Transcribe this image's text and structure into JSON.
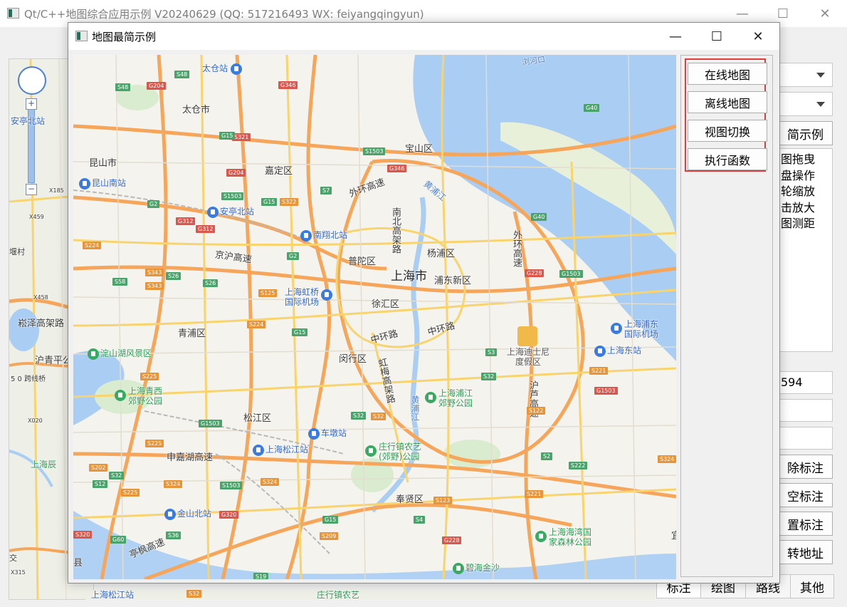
{
  "main_window": {
    "title": "Qt/C++地图综合应用示例 V20240629 (QQ: 517216493 WX: feiyangqingyun)",
    "minimize": "—",
    "maximize": "☐",
    "close": "✕"
  },
  "back_map_labels": {
    "l1": "安亭北站",
    "l2": "X185",
    "l3": "X459",
    "l4": "堰村",
    "l5": "X458",
    "l6": "崧泽高架路",
    "l7": "沪青平公",
    "l8": "5 0 跨线桥",
    "l9": "X020",
    "l10": "上海辰",
    "l11": "交",
    "l12": "X315",
    "l13": "上海松江站",
    "l14": "庄行镇农艺",
    "l15": "S32"
  },
  "right_panel": {
    "demo_button": "简示例",
    "list_items": [
      "图拖曳",
      "盘操作",
      "轮缩放",
      "击放大",
      "图测距"
    ],
    "coordinate_value": "594",
    "remove_marker": "除标注",
    "clear_marker": "空标注",
    "reset_marker": "置标注",
    "coord_to_address": "转地址",
    "tabs": [
      "标注",
      "绘图",
      "路线",
      "其他"
    ]
  },
  "dialog": {
    "title": "地图最简示例",
    "minimize": "—",
    "maximize": "☐",
    "close": "✕",
    "buttons": {
      "online_map": "在线地图",
      "offline_map": "离线地图",
      "view_switch": "视图切换",
      "exec_function": "执行函数"
    }
  },
  "colors": {
    "highlight_border": "#e23b3b",
    "water": "#a9cdf3",
    "highway": "#f5a65b",
    "arterial": "#f9d36c"
  },
  "map": {
    "city": "上海市",
    "districts": [
      "太仓市",
      "昆山市",
      "嘉定区",
      "宝山区",
      "普陀区",
      "杨浦区",
      "浦东新区",
      "徐汇区",
      "青浦区",
      "闵行区",
      "松江区",
      "奉贤区"
    ],
    "roads": [
      "外环高速",
      "京沪高速",
      "中环路",
      "中环路",
      "虹梅高架路",
      "申嘉湖高速",
      "亭枫高速"
    ],
    "vertical_roads": [
      "南北高架路",
      "外环高速",
      "沪芦高速"
    ],
    "rivers": [
      "黄浦江",
      "黄浦江",
      "黄浦江"
    ],
    "pois": {
      "taicang_station": "太仓站",
      "kunshan_south": "昆山南站",
      "anting_north": "安亭北站",
      "nanxiang_north": "南翔北站",
      "hongqiao_airport_1": "上海虹桥",
      "hongqiao_airport_2": "国际机场",
      "pudong_airport_1": "上海浦东",
      "pudong_airport_2": "国际机场",
      "shanghai_east": "上海东站",
      "disney_1": "上海迪士尼",
      "disney_2": "度假区",
      "dianshan_lake": "淀山湖风景区",
      "qingxi_park_1": "上海青西",
      "qingxi_park_2": "郊野公园",
      "pujiang_park_1": "上海浦江",
      "pujiang_park_2": "郊野公园",
      "chedun_station": "车墩站",
      "songjiang_station": "上海松江站",
      "zhuanghang_park_1": "庄行镇农艺",
      "zhuanghang_park_2": "(郊野)公园",
      "jinshan_north": "金山北站",
      "bay_forest_1": "上海海湾国",
      "bay_forest_2": "家森林公园",
      "bihai_jinsha": "碧海金沙",
      "county": "县",
      "edge_char": "宜",
      "top_river": "浏河口"
    },
    "shields": [
      "S48",
      "G204",
      "G346",
      "S48",
      "S321",
      "G15",
      "S1503",
      "G346",
      "G40",
      "G204",
      "S1503",
      "G15",
      "S322",
      "S7",
      "G2",
      "G312",
      "G312",
      "G40",
      "S224",
      "G2",
      "S343",
      "S26",
      "G228",
      "G1503",
      "S58",
      "S343",
      "S26",
      "S125",
      "S224",
      "G15",
      "S3",
      "S221",
      "S225",
      "S32",
      "G1503",
      "S32",
      "S32",
      "G1503",
      "S122",
      "S225",
      "S202",
      "S32",
      "S12",
      "S225",
      "S324",
      "S1503",
      "S324",
      "S324",
      "S2",
      "S222",
      "G320",
      "G15",
      "S123",
      "S221",
      "S4",
      "S320",
      "G60",
      "S36",
      "S209",
      "G228",
      "S19"
    ]
  }
}
